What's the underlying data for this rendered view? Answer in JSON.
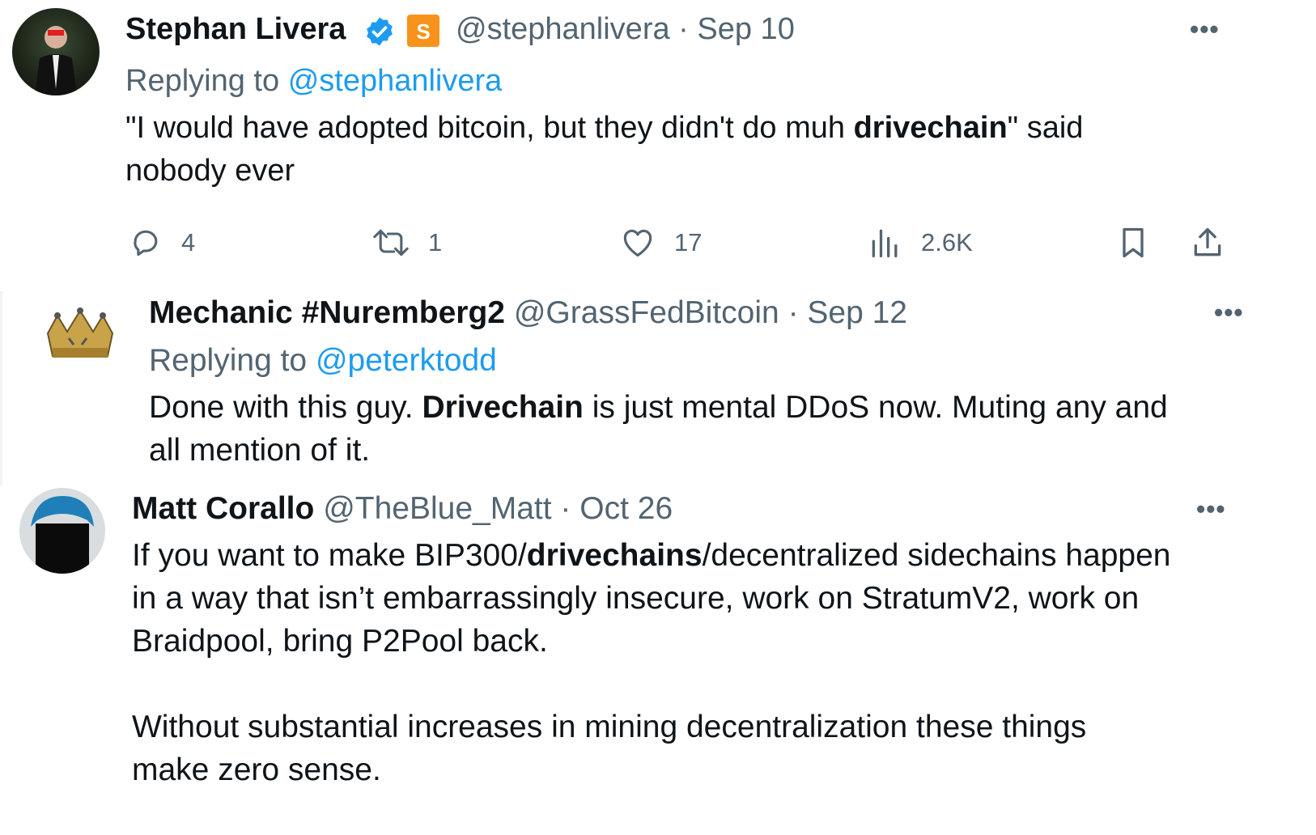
{
  "tweets": [
    {
      "name": "Stephan Livera",
      "handle": "@stephanlivera",
      "date": "· Sep 10",
      "replying_prefix": "Replying to",
      "replying_handle": "@stephanlivera",
      "lines": [
        {
          "pre": "\"I would have adopted bitcoin, but they didn't do muh ",
          "bold": "drivechain",
          "post": "\" said"
        },
        {
          "pre": "nobody ever",
          "bold": "",
          "post": ""
        }
      ],
      "stats": {
        "replies": "4",
        "reposts": "1",
        "likes": "17",
        "views": "2.6K"
      },
      "more": "•••"
    },
    {
      "name": "Mechanic #Nuremberg2",
      "handle": "@GrassFedBitcoin",
      "date": "· Sep 12",
      "replying_prefix": "Replying to",
      "replying_handle": "@peterktodd",
      "lines": [
        {
          "pre": "Done with this guy. ",
          "bold": "Drivechain",
          "post": " is just mental DDoS now. Muting any and"
        },
        {
          "pre": "all mention of it.",
          "bold": "",
          "post": ""
        }
      ],
      "more": "•••"
    },
    {
      "name": "Matt Corallo",
      "handle": "@TheBlue_Matt",
      "date": "· Oct 26",
      "lines": [
        {
          "pre": "If you want to make BIP300/",
          "bold": "drivechains",
          "post": "/decentralized sidechains happen"
        },
        {
          "pre": "in a way that isn’t embarrassingly insecure, work on StratumV2, work on",
          "bold": "",
          "post": ""
        },
        {
          "pre": "Braidpool, bring P2Pool back.",
          "bold": "",
          "post": ""
        },
        {
          "pre": "Without substantial increases in mining decentralization these things",
          "bold": "",
          "post": ""
        },
        {
          "pre": "make zero sense.",
          "bold": "",
          "post": ""
        }
      ],
      "more": "•••"
    }
  ],
  "colors": {
    "link": "#1d9bf0",
    "muted": "#536471",
    "text": "#0f1419",
    "verified": "#1d9bf0",
    "badge": "#f7931a"
  },
  "icons": [
    "reply-icon",
    "repost-icon",
    "like-icon",
    "views-icon",
    "bookmark-icon",
    "share-icon",
    "verified-icon",
    "substack-badge-icon",
    "more-icon"
  ]
}
